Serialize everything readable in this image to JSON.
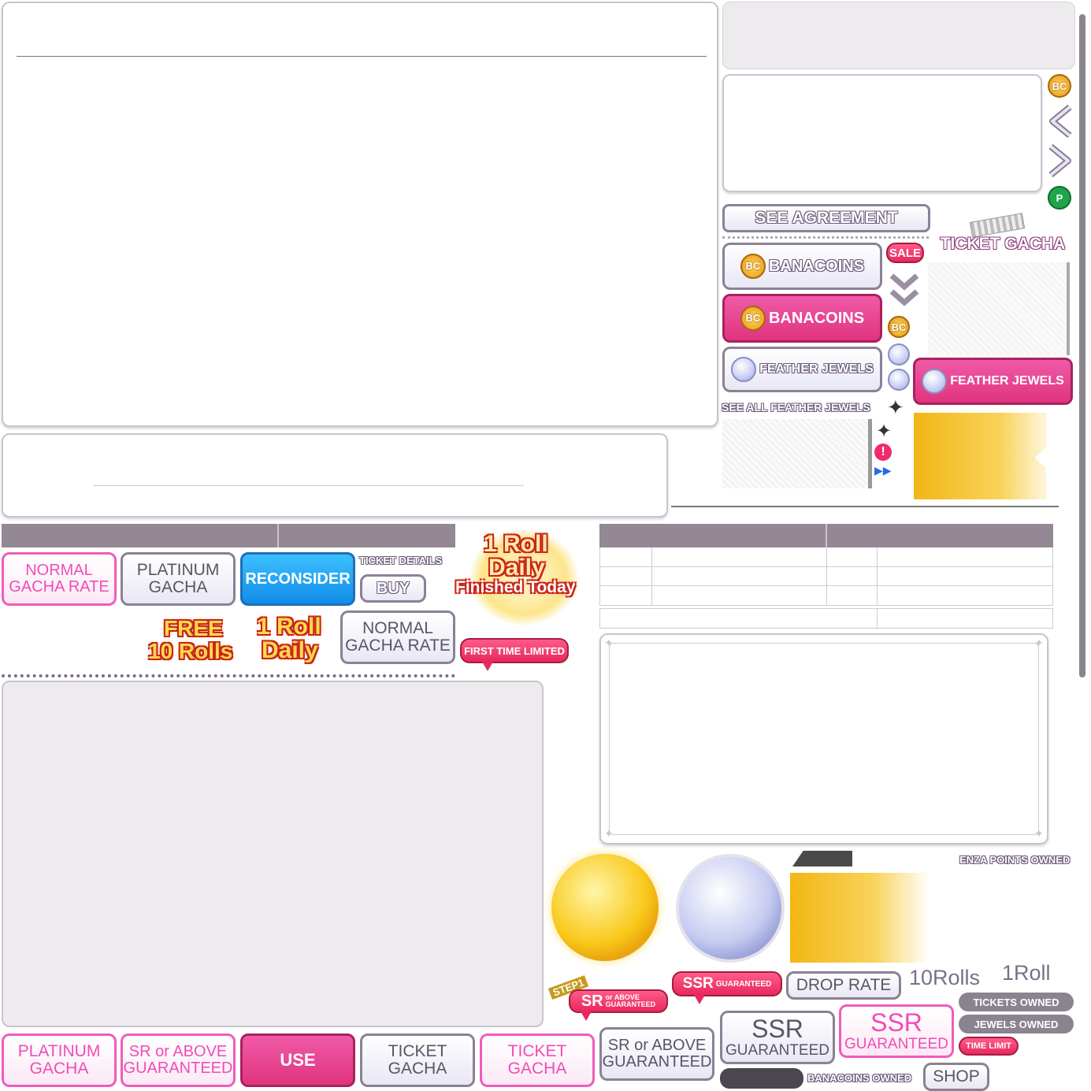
{
  "colors": {
    "pink": "#f05cbc",
    "magenta": "#e0347f",
    "grey": "#8b8196",
    "blue": "#128ce8",
    "gold": "#f2b615",
    "header": "#938894"
  },
  "icons": {
    "banacoin": "bc-coin-icon",
    "paid": "p-coin-icon",
    "left": "chevron-left-icon",
    "right": "chevron-right-icon",
    "down": "double-chevron-down-icon",
    "jewel": "feather-jewel-icon",
    "sparkle": "sparkle-icon",
    "alert": "exclamation-icon",
    "fast_forward": "fast-forward-icon"
  },
  "coins": {
    "bc": "BC",
    "p": "P"
  },
  "labels": {
    "see_agreement": "SEE AGREEMENT",
    "ticket_gacha_title": "TICKET GACHA",
    "banacoins": "BANACOINS",
    "sale": "SALE",
    "feather_jewels": "FEATHER JEWELS",
    "see_all_feather_jewels": "SEE ALL FEATHER JEWELS",
    "normal_gacha_rate": "NORMAL GACHA RATE",
    "platinum_gacha": "PLATINUM GACHA",
    "reconsider": "RECONSIDER",
    "ticket_details": "TICKET DETAILS",
    "buy": "BUY",
    "roll_daily_line1": "1 Roll",
    "roll_daily_line2": "Daily",
    "finished_today": "Finished Today",
    "free": "FREE",
    "ten_rolls": "10 Rolls",
    "first_time_limited": "FIRST TIME LIMITED",
    "enza_points_owned": "ENZA POINTS OWNED",
    "step1": "STEP1",
    "sr_or": "SR",
    "or": "or",
    "above": "ABOVE",
    "guaranteed": "GUARANTEED",
    "ssr": "SSR",
    "drop_rate": "DROP RATE",
    "ten_rolls_plain": "10Rolls",
    "one_roll_plain": "1Roll",
    "tickets_owned": "TICKETS OWNED",
    "jewels_owned": "JEWELS OWNED",
    "time_limit": "TIME LIMIT",
    "banacoins_owned": "BANACOINS OWNED",
    "shop": "SHOP",
    "use": "USE",
    "ticket_gacha": "TICKET GACHA",
    "sr_or_above_guaranteed": "SR or ABOVE GUARANTEED"
  }
}
